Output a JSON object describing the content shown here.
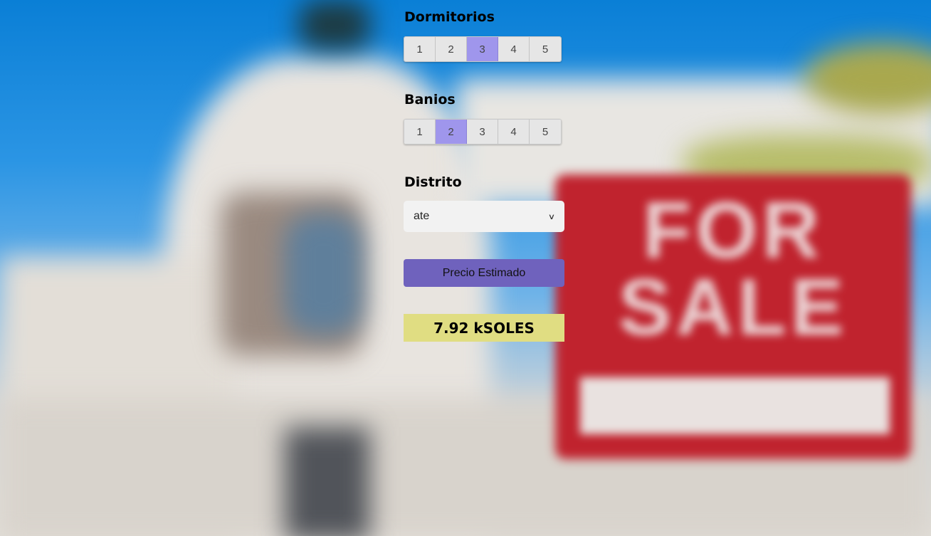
{
  "background": {
    "sign_line1": "FOR",
    "sign_line2": "SALE"
  },
  "dormitorios": {
    "title": "Dormitorios",
    "options": [
      "1",
      "2",
      "3",
      "4",
      "5"
    ],
    "selected": "3"
  },
  "banios": {
    "title": "Banios",
    "options": [
      "1",
      "2",
      "3",
      "4",
      "5"
    ],
    "selected": "2"
  },
  "distrito": {
    "title": "Distrito",
    "selected_value": "ate"
  },
  "estimate_button": {
    "label": "Precio Estimado"
  },
  "result": {
    "text": "7.92 kSOLES"
  },
  "colors": {
    "accent": "#6f62bd",
    "selected_segment": "#9f96ec",
    "result_background": "#e0dd82"
  }
}
